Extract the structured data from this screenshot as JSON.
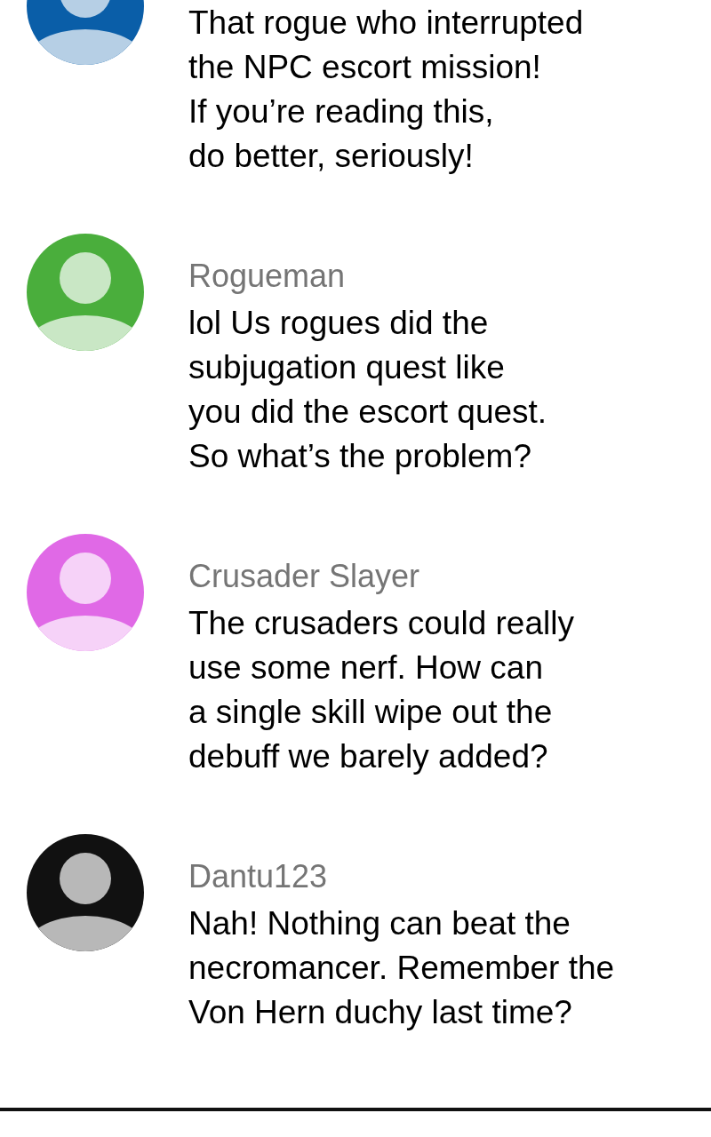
{
  "comments": [
    {
      "color": "#0a5ea8",
      "text": "That rogue who interrupted\nthe NPC escort mission!\nIf you’re reading this,\ndo better, seriously!"
    },
    {
      "author": "Rogueman",
      "color": "#4aae3c",
      "text": "lol Us rogues did the\nsubjugation quest like\nyou did the escort quest.\nSo what’s the problem?"
    },
    {
      "author": "Crusader Slayer",
      "color": "#e069e6",
      "text": "The crusaders could really\nuse some nerf. How can\na single skill wipe out the\ndebuff we barely added?"
    },
    {
      "author": "Dantu123",
      "color": "#111111",
      "text": "Nah! Nothing can beat the\nnecromancer. Remember the\nVon Hern duchy last time?"
    }
  ]
}
